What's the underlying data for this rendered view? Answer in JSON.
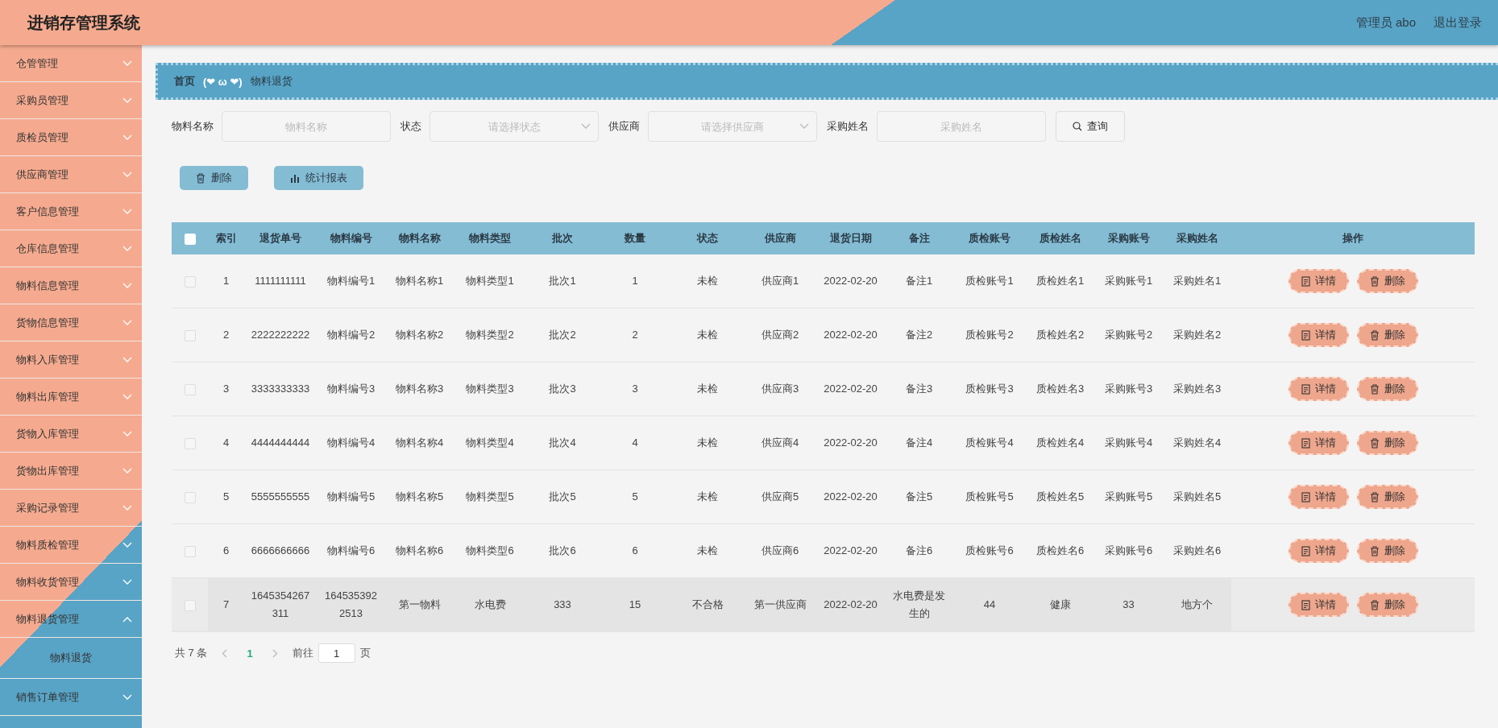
{
  "header": {
    "title": "进销存管理系统",
    "user": "管理员 abo",
    "logout": "退出登录"
  },
  "sidebar": {
    "items": [
      {
        "label": "仓管管理",
        "expanded": false
      },
      {
        "label": "采购员管理",
        "expanded": false
      },
      {
        "label": "质检员管理",
        "expanded": false
      },
      {
        "label": "供应商管理",
        "expanded": false
      },
      {
        "label": "客户信息管理",
        "expanded": false
      },
      {
        "label": "仓库信息管理",
        "expanded": false
      },
      {
        "label": "物料信息管理",
        "expanded": false
      },
      {
        "label": "货物信息管理",
        "expanded": false
      },
      {
        "label": "物料入库管理",
        "expanded": false
      },
      {
        "label": "物料出库管理",
        "expanded": false
      },
      {
        "label": "货物入库管理",
        "expanded": false
      },
      {
        "label": "货物出库管理",
        "expanded": false
      },
      {
        "label": "采购记录管理",
        "expanded": false
      },
      {
        "label": "物料质检管理",
        "expanded": false
      },
      {
        "label": "物料收货管理",
        "expanded": false
      },
      {
        "label": "物料退货管理",
        "expanded": true,
        "children": [
          {
            "label": "物料退货"
          }
        ]
      },
      {
        "label": "销售订单管理",
        "expanded": false
      }
    ]
  },
  "breadcrumb": {
    "home": "首页",
    "separator": "(❤ ω ❤)",
    "current": "物料退货"
  },
  "search": {
    "fields": [
      {
        "kind": "text",
        "label": "物料名称",
        "placeholder": "物料名称"
      },
      {
        "kind": "select",
        "label": "状态",
        "placeholder": "请选择状态"
      },
      {
        "kind": "select",
        "label": "供应商",
        "placeholder": "请选择供应商"
      },
      {
        "kind": "text",
        "label": "采购姓名",
        "placeholder": "采购姓名"
      }
    ],
    "button": "查询"
  },
  "toolbar": [
    {
      "kind": "delete",
      "label": "删除"
    },
    {
      "kind": "chart",
      "label": "统计报表"
    }
  ],
  "table": {
    "all_checked": false,
    "columns": [
      "索引",
      "退货单号",
      "物料编号",
      "物料名称",
      "物料类型",
      "批次",
      "数量",
      "状态",
      "供应商",
      "退货日期",
      "备注",
      "质检账号",
      "质检姓名",
      "采购账号",
      "采购姓名",
      "操作"
    ],
    "rows": [
      {
        "checked": false,
        "highlighted": false,
        "cells": [
          "1",
          "1111111111",
          "物料编号1",
          "物料名称1",
          "物料类型1",
          "批次1",
          "1",
          "未检",
          "供应商1",
          "2022-02-20",
          "备注1",
          "质检账号1",
          "质检姓名1",
          "采购账号1",
          "采购姓名1"
        ],
        "actions": [
          {
            "kind": "detail",
            "label": "详情"
          },
          {
            "kind": "delete",
            "label": "删除"
          }
        ]
      },
      {
        "checked": false,
        "highlighted": false,
        "cells": [
          "2",
          "2222222222",
          "物料编号2",
          "物料名称2",
          "物料类型2",
          "批次2",
          "2",
          "未检",
          "供应商2",
          "2022-02-20",
          "备注2",
          "质检账号2",
          "质检姓名2",
          "采购账号2",
          "采购姓名2"
        ],
        "actions": [
          {
            "kind": "detail",
            "label": "详情"
          },
          {
            "kind": "delete",
            "label": "删除"
          }
        ]
      },
      {
        "checked": false,
        "highlighted": false,
        "cells": [
          "3",
          "3333333333",
          "物料编号3",
          "物料名称3",
          "物料类型3",
          "批次3",
          "3",
          "未检",
          "供应商3",
          "2022-02-20",
          "备注3",
          "质检账号3",
          "质检姓名3",
          "采购账号3",
          "采购姓名3"
        ],
        "actions": [
          {
            "kind": "detail",
            "label": "详情"
          },
          {
            "kind": "delete",
            "label": "删除"
          }
        ]
      },
      {
        "checked": false,
        "highlighted": false,
        "cells": [
          "4",
          "4444444444",
          "物料编号4",
          "物料名称4",
          "物料类型4",
          "批次4",
          "4",
          "未检",
          "供应商4",
          "2022-02-20",
          "备注4",
          "质检账号4",
          "质检姓名4",
          "采购账号4",
          "采购姓名4"
        ],
        "actions": [
          {
            "kind": "detail",
            "label": "详情"
          },
          {
            "kind": "delete",
            "label": "删除"
          }
        ]
      },
      {
        "checked": false,
        "highlighted": false,
        "cells": [
          "5",
          "5555555555",
          "物料编号5",
          "物料名称5",
          "物料类型5",
          "批次5",
          "5",
          "未检",
          "供应商5",
          "2022-02-20",
          "备注5",
          "质检账号5",
          "质检姓名5",
          "采购账号5",
          "采购姓名5"
        ],
        "actions": [
          {
            "kind": "detail",
            "label": "详情"
          },
          {
            "kind": "delete",
            "label": "删除"
          }
        ]
      },
      {
        "checked": false,
        "highlighted": false,
        "cells": [
          "6",
          "6666666666",
          "物料编号6",
          "物料名称6",
          "物料类型6",
          "批次6",
          "6",
          "未检",
          "供应商6",
          "2022-02-20",
          "备注6",
          "质检账号6",
          "质检姓名6",
          "采购账号6",
          "采购姓名6"
        ],
        "actions": [
          {
            "kind": "detail",
            "label": "详情"
          },
          {
            "kind": "delete",
            "label": "删除"
          }
        ]
      },
      {
        "checked": false,
        "highlighted": true,
        "cells": [
          "7",
          "1645354267311",
          "1645353922513",
          "第一物料",
          "水电费",
          "333",
          "15",
          "不合格",
          "第一供应商",
          "2022-02-20",
          "水电费是发生的",
          "44",
          "健康",
          "33",
          "地方个"
        ],
        "actions": [
          {
            "kind": "detail",
            "label": "详情"
          },
          {
            "kind": "delete",
            "label": "删除"
          }
        ]
      }
    ]
  },
  "pagination": {
    "total": "共 7 条",
    "pages": [
      {
        "label": "1",
        "selected": true
      }
    ],
    "goto_label": "前往",
    "goto_value": "1",
    "goto_suffix": "页"
  }
}
